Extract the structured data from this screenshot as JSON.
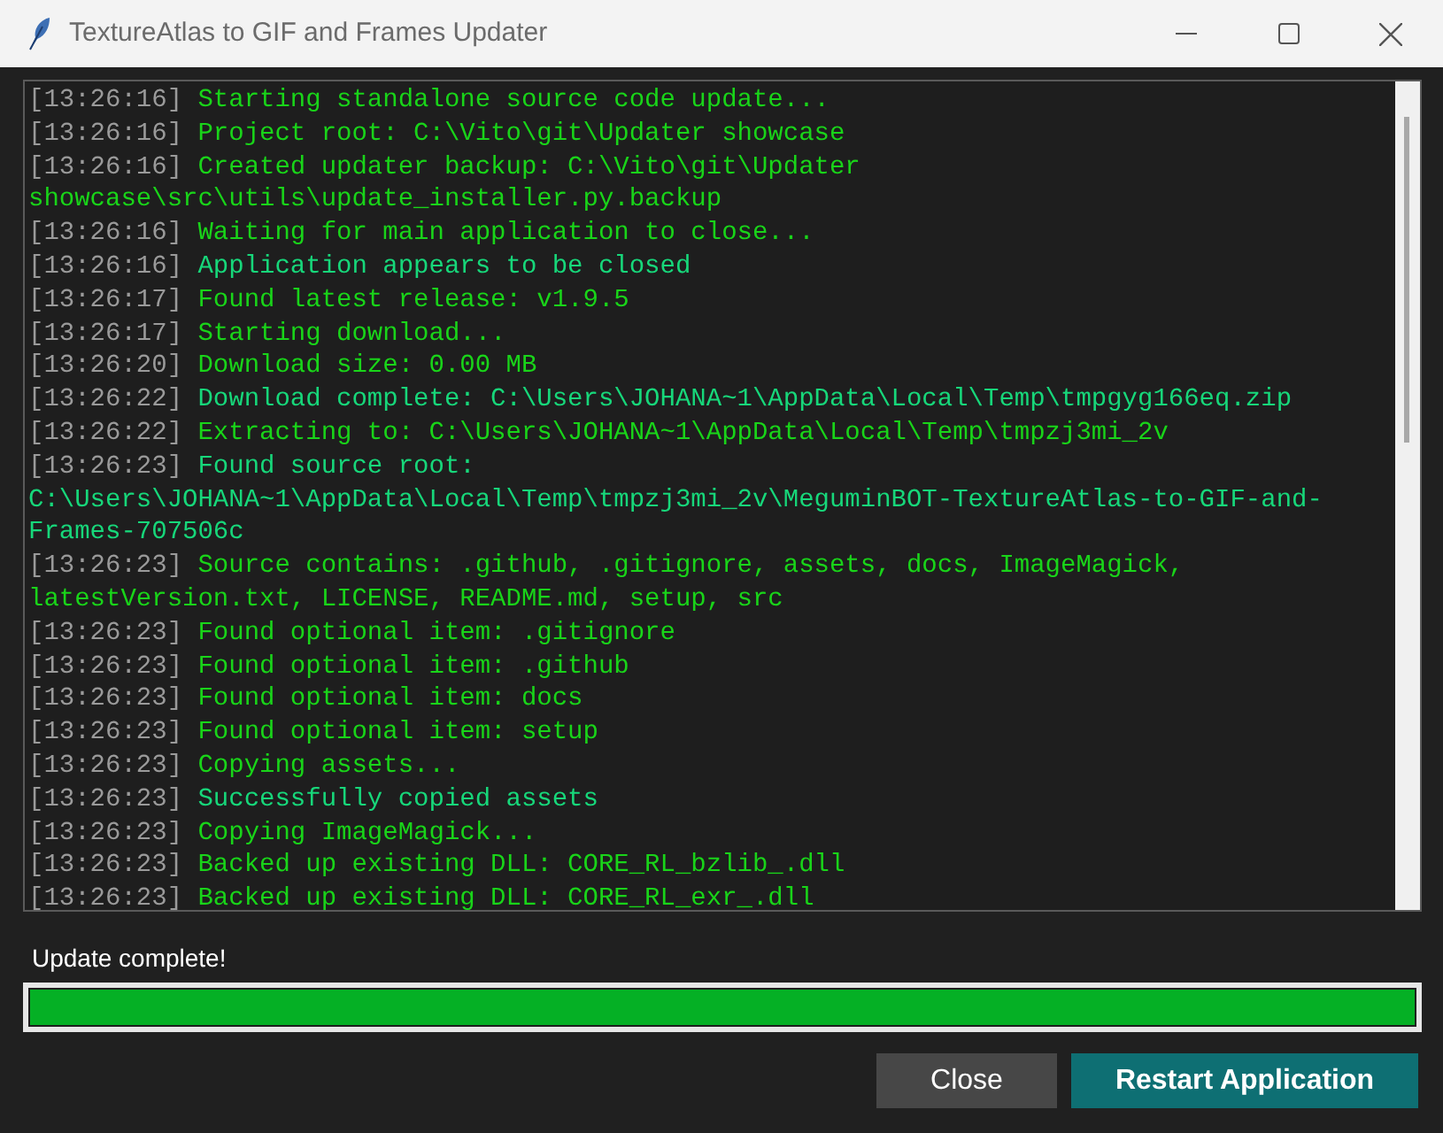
{
  "window": {
    "title": "TextureAtlas to GIF and Frames Updater"
  },
  "log": [
    {
      "time": "[13:26:16]",
      "message": "Starting standalone source code update...",
      "kind": "info"
    },
    {
      "time": "[13:26:16]",
      "message": "Project root: C:\\Vito\\git\\Updater showcase",
      "kind": "info"
    },
    {
      "time": "[13:26:16]",
      "message": "Created updater backup: C:\\Vito\\git\\Updater showcase\\src\\utils\\update_installer.py.backup",
      "kind": "info"
    },
    {
      "time": "[13:26:16]",
      "message": "Waiting for main application to close...",
      "kind": "info"
    },
    {
      "time": "[13:26:16]",
      "message": "Application appears to be closed",
      "kind": "success"
    },
    {
      "time": "[13:26:17]",
      "message": "Found latest release: v1.9.5",
      "kind": "info"
    },
    {
      "time": "[13:26:17]",
      "message": "Starting download...",
      "kind": "info"
    },
    {
      "time": "[13:26:20]",
      "message": "Download size: 0.00 MB",
      "kind": "info"
    },
    {
      "time": "[13:26:22]",
      "message": "Download complete: C:\\Users\\JOHANA~1\\AppData\\Local\\Temp\\tmpgyg166eq.zip",
      "kind": "success"
    },
    {
      "time": "[13:26:22]",
      "message": "Extracting to: C:\\Users\\JOHANA~1\\AppData\\Local\\Temp\\tmpzj3mi_2v",
      "kind": "info"
    },
    {
      "time": "[13:26:23]",
      "message": "Found source root: C:\\Users\\JOHANA~1\\AppData\\Local\\Temp\\tmpzj3mi_2v\\MeguminBOT-TextureAtlas-to-GIF-and-Frames-707506c",
      "kind": "success"
    },
    {
      "time": "[13:26:23]",
      "message": "Source contains: .github, .gitignore, assets, docs, ImageMagick, latestVersion.txt, LICENSE, README.md, setup, src",
      "kind": "info"
    },
    {
      "time": "[13:26:23]",
      "message": "Found optional item: .gitignore",
      "kind": "info"
    },
    {
      "time": "[13:26:23]",
      "message": "Found optional item: .github",
      "kind": "info"
    },
    {
      "time": "[13:26:23]",
      "message": "Found optional item: docs",
      "kind": "info"
    },
    {
      "time": "[13:26:23]",
      "message": "Found optional item: setup",
      "kind": "info"
    },
    {
      "time": "[13:26:23]",
      "message": "Copying assets...",
      "kind": "info"
    },
    {
      "time": "[13:26:23]",
      "message": "Successfully copied assets",
      "kind": "success"
    },
    {
      "time": "[13:26:23]",
      "message": "Copying ImageMagick...",
      "kind": "info"
    },
    {
      "time": "[13:26:23]",
      "message": "Backed up existing DLL: CORE_RL_bzlib_.dll",
      "kind": "info"
    },
    {
      "time": "[13:26:23]",
      "message": "Backed up existing DLL: CORE_RL_exr_.dll",
      "kind": "info"
    }
  ],
  "status": "Update complete!",
  "progress": {
    "level": 1.0
  },
  "buttons": [
    {
      "label": "Close",
      "kind": "secondary"
    },
    {
      "label": "Restart Application",
      "kind": "primary"
    }
  ]
}
